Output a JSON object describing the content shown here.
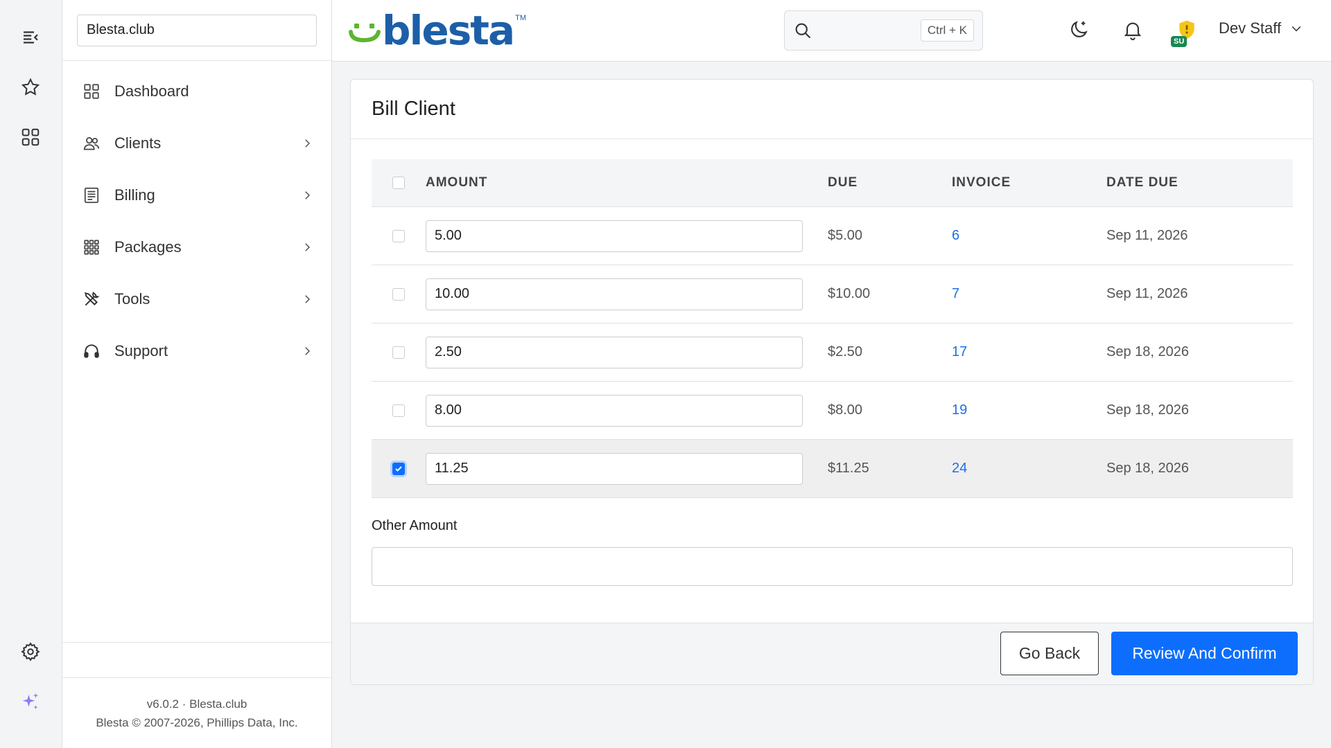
{
  "sidebar": {
    "company": "Blesta.club",
    "items": [
      {
        "label": "Dashboard",
        "has_children": false
      },
      {
        "label": "Clients",
        "has_children": true
      },
      {
        "label": "Billing",
        "has_children": true
      },
      {
        "label": "Packages",
        "has_children": true
      },
      {
        "label": "Tools",
        "has_children": true
      },
      {
        "label": "Support",
        "has_children": true
      }
    ],
    "footer": {
      "version": "v6.0.2 · Blesta.club",
      "copyright": "Blesta © 2007-2026, Phillips Data, Inc."
    }
  },
  "header": {
    "logo_text": "blesta",
    "logo_tm": "TM",
    "search_shortcut": "Ctrl + K",
    "role_badge": "SU",
    "user_name": "Dev Staff"
  },
  "page": {
    "title": "Bill Client",
    "columns": [
      "AMOUNT",
      "DUE",
      "INVOICE",
      "DATE DUE"
    ],
    "rows": [
      {
        "amount": "5.00",
        "due": "$5.00",
        "invoice": "6",
        "date_due": "Sep 11, 2026",
        "checked": false
      },
      {
        "amount": "10.00",
        "due": "$10.00",
        "invoice": "7",
        "date_due": "Sep 11, 2026",
        "checked": false
      },
      {
        "amount": "2.50",
        "due": "$2.50",
        "invoice": "17",
        "date_due": "Sep 18, 2026",
        "checked": false
      },
      {
        "amount": "8.00",
        "due": "$8.00",
        "invoice": "19",
        "date_due": "Sep 18, 2026",
        "checked": false
      },
      {
        "amount": "11.25",
        "due": "$11.25",
        "invoice": "24",
        "date_due": "Sep 18, 2026",
        "checked": true
      }
    ],
    "other_amount_label": "Other Amount",
    "other_amount_value": "",
    "buttons": {
      "back": "Go Back",
      "confirm": "Review And Confirm"
    }
  },
  "colors": {
    "primary": "#0d6efd",
    "link": "#1f6fe5",
    "logo_blue": "#1c5fa8",
    "logo_green": "#5cb531",
    "badge_green": "#198754",
    "shield_yellow": "#f5c518",
    "sparkle_purple": "#8b7cf6"
  }
}
